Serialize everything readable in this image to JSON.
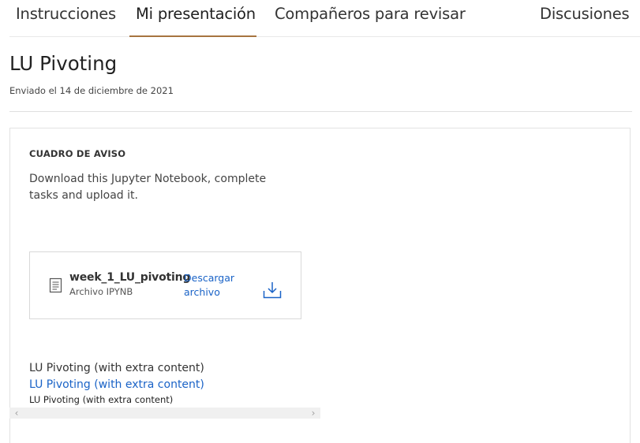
{
  "tabs": [
    {
      "label": "Instrucciones",
      "active": false
    },
    {
      "label": "Mi presentación",
      "active": true
    },
    {
      "label": "Compañeros para revisar",
      "active": false
    },
    {
      "label": "Discusiones",
      "active": false
    }
  ],
  "submission": {
    "title": "LU Pivoting",
    "submitted_text": "Enviado el 14 de diciembre de 2021"
  },
  "prompt": {
    "heading": "CUADRO DE AVISO",
    "body": "Download this Jupyter Notebook, complete tasks and upload it."
  },
  "file": {
    "name": "week_1_LU_pivoting",
    "type_label": "Archivo IPYNB",
    "download_label": "Descargar archivo",
    "icon": "document-icon",
    "download_icon": "download-icon"
  },
  "content_lines": {
    "plain": "LU Pivoting (with extra content)",
    "link": "LU Pivoting (with extra content)",
    "small": "LU Pivoting (with extra content)"
  },
  "scrollbar": {
    "left_arrow": "‹",
    "right_arrow": "›"
  },
  "colors": {
    "active_tab_underline": "#a6743f",
    "link": "#1a63c7"
  }
}
